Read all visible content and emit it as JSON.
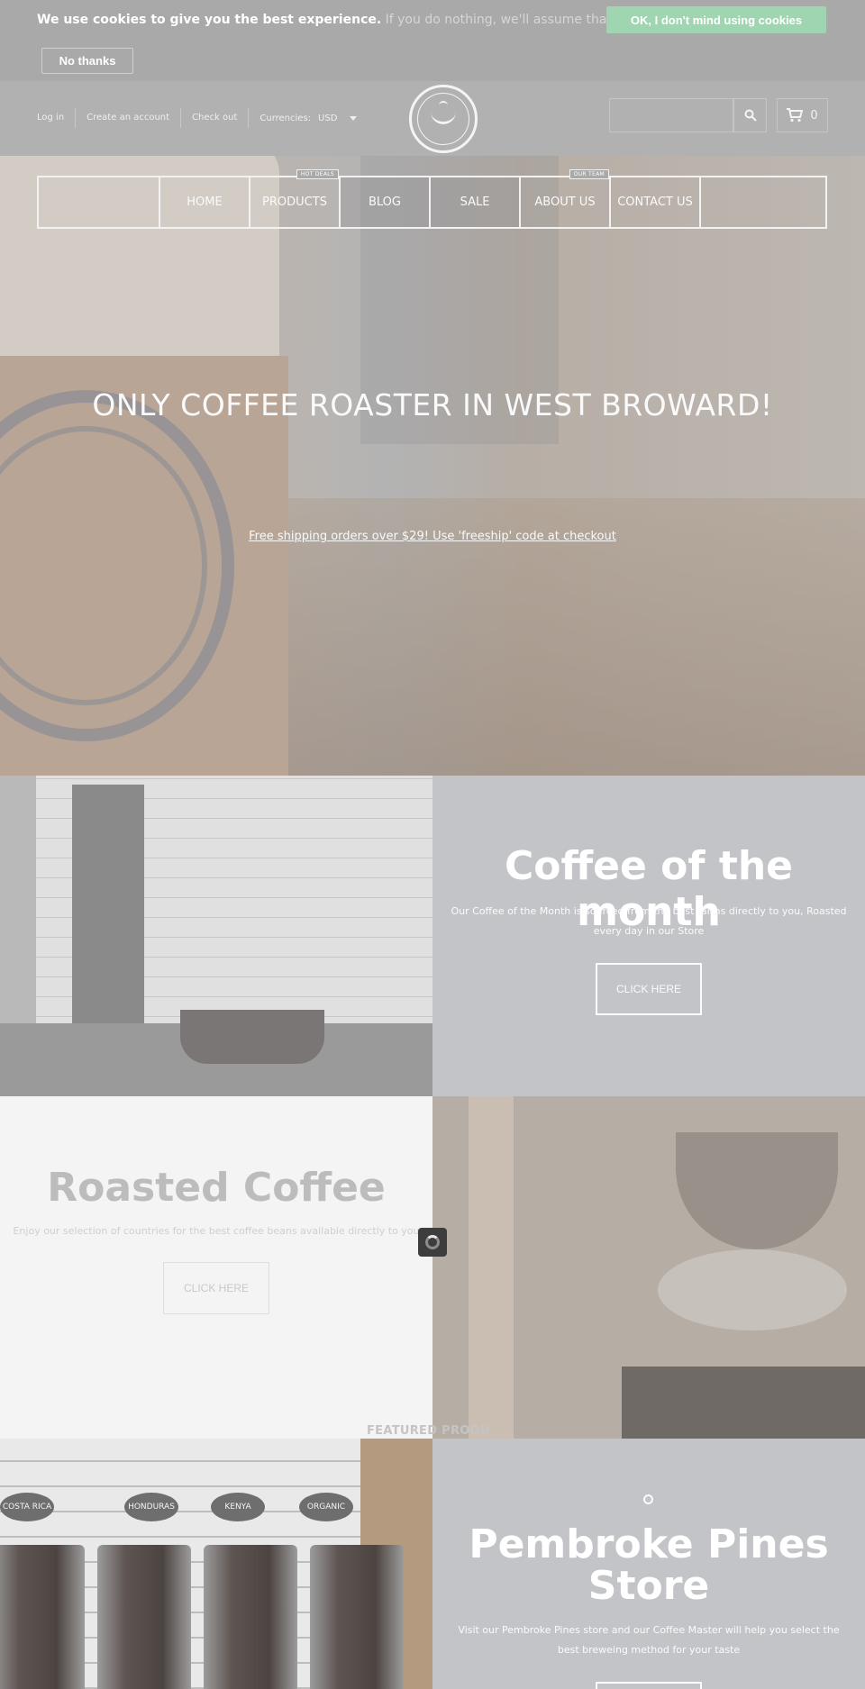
{
  "cookie": {
    "bold_text": "We use cookies to give you the best experience.",
    "muted_text": "If you do nothing, we'll assume that's OK.",
    "accept_label": "OK, I don't mind using cookies",
    "decline_label": "No thanks"
  },
  "header": {
    "links": [
      "Log in",
      "Create an account",
      "Check out"
    ],
    "currency_label": "Currencies:",
    "currency_value": "USD",
    "search_placeholder": "",
    "cart_count": "0"
  },
  "nav": {
    "items": [
      {
        "label": "HOME",
        "tag": ""
      },
      {
        "label": "PRODUCTS",
        "tag": "HOT DEALS"
      },
      {
        "label": "BLOG",
        "tag": ""
      },
      {
        "label": "SALE",
        "tag": ""
      },
      {
        "label": "ABOUT US",
        "tag": "OUR TEAM"
      },
      {
        "label": "CONTACT US",
        "tag": ""
      }
    ]
  },
  "hero": {
    "title": "ONLY COFFEE ROASTER IN WEST BROWARD!",
    "subtitle": "Free shipping orders over $29! Use 'freeship' code at checkout"
  },
  "coffee_of_month": {
    "title": "Coffee of the month",
    "text": "Our Coffee of the Month is sourced from the best farms directly to you, Roasted every day in our Store",
    "button": "CLICK HERE"
  },
  "roasted": {
    "title": "Roasted Coffee",
    "text": "Enjoy our selection of countries for the best coffee beans available directly to you",
    "button": "CLICK HERE"
  },
  "featured_label": "FEATURED PRODU",
  "jar_labels": [
    "COSTA RICA",
    "HONDURAS",
    "KENYA",
    "ORGANIC"
  ],
  "pembroke": {
    "title_line1": "Pembroke Pines",
    "title_line2": "Store",
    "text": "Visit our Pembroke Pines store and our Coffee Master will help you select the best breweing method for your taste"
  }
}
